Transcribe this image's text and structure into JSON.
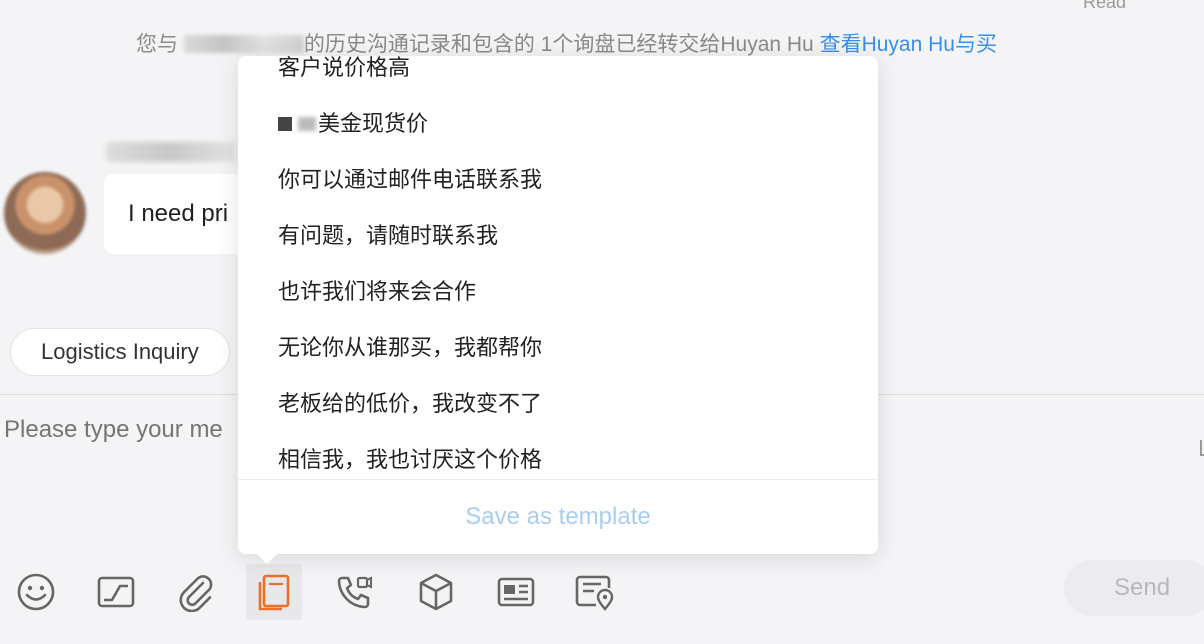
{
  "header": {
    "read_status": "Read"
  },
  "notice": {
    "prefix": "您与 ",
    "middle": "的历史沟通记录和包含的 1个询盘已经转交给Huyan Hu ",
    "link": "查看Huyan Hu与买"
  },
  "message": {
    "text": "I need pri"
  },
  "chips": {
    "logistics": "Logistics Inquiry"
  },
  "composer": {
    "placeholder": "Please type your me"
  },
  "send_label": "Send",
  "templates": {
    "items": [
      "客户说价格高",
      "美金现货价",
      "你可以通过邮件电话联系我",
      "有问题，请随时联系我",
      "也许我们将来会合作",
      "无论你从谁那买，我都帮你",
      "老板给的低价，我改变不了",
      "相信我，我也讨厌这个价格"
    ],
    "save_label": "Save as template"
  },
  "colors": {
    "link": "#3a8ee6",
    "active_icon": "#e8702a",
    "save_disabled": "#a9cdf0"
  },
  "toolbar_icons": [
    "emoji-icon",
    "screenshot-icon",
    "attachment-icon",
    "template-icon",
    "video-call-icon",
    "product-icon",
    "business-card-icon",
    "address-icon"
  ]
}
